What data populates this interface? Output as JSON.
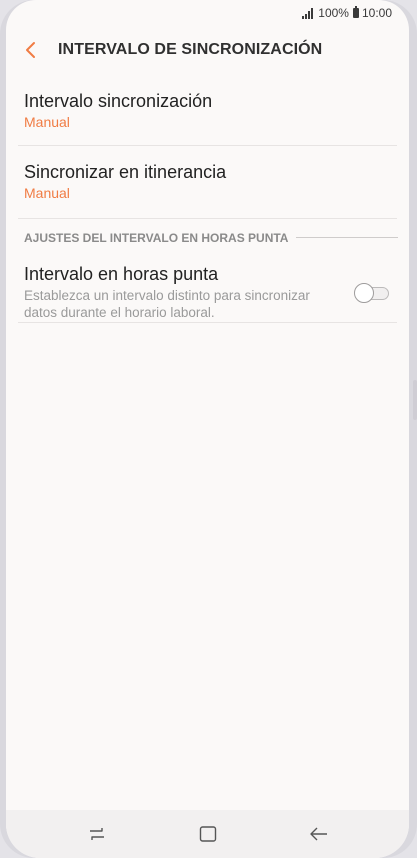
{
  "status_bar": {
    "battery_percent": "100%",
    "time": "10:00",
    "icons": [
      "signal-icon",
      "battery-icon"
    ]
  },
  "app_bar": {
    "back_icon": "back-icon",
    "title": "INTERVALO DE SINCRONIZACIÓN"
  },
  "items": [
    {
      "title": "Intervalo sincronización",
      "value": "Manual"
    },
    {
      "title": "Sincronizar en itinerancia",
      "value": "Manual"
    }
  ],
  "peak_section": {
    "header": "AJUSTES DEL INTERVALO EN HORAS PUNTA",
    "item": {
      "title": "Intervalo en horas punta",
      "description": "Establezca un intervalo distinto para sincronizar datos durante el horario laboral.",
      "toggle_on": false
    }
  },
  "nav_bar": {
    "icons": [
      "recent-apps-icon",
      "home-icon",
      "back-arrow-icon"
    ]
  },
  "colors": {
    "accent": "#f07c44",
    "background": "#fbf9f8",
    "nav_background": "#f2f0f0"
  }
}
